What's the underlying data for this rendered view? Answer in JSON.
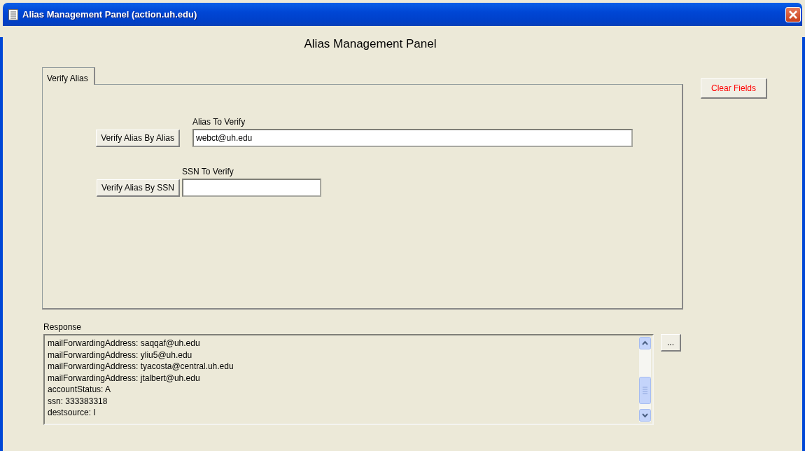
{
  "window": {
    "title": "Alias Management Panel (action.uh.edu)"
  },
  "heading": "Alias Management Panel",
  "tabs": [
    {
      "label": "Verify Alias",
      "selected": true
    }
  ],
  "clear_button": "Clear Fields",
  "verify_rows": [
    {
      "button": "Verify Alias By Alias",
      "label": "Alias To Verify",
      "value": "webct@uh.edu",
      "wide": true
    },
    {
      "button": "Verify Alias By SSN",
      "label": "SSN To Verify",
      "wide": false
    }
  ],
  "response": {
    "label": "Response",
    "lines": [
      "mailForwardingAddress: saqqaf@uh.edu",
      "mailForwardingAddress: yliu5@uh.edu",
      "mailForwardingAddress: tyacosta@central.uh.edu",
      "mailForwardingAddress: jtalbert@uh.edu",
      "accountStatus: A",
      "ssn: 333383318",
      "destsource: I"
    ],
    "more_button": "..."
  }
}
